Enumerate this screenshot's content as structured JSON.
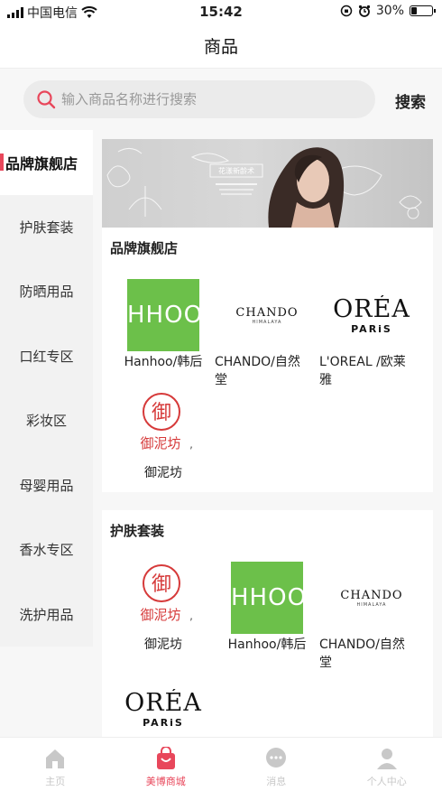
{
  "status_bar": {
    "carrier": "中国电信",
    "time": "15:42",
    "battery": "30%",
    "battery_level": 0.3
  },
  "header": {
    "title": "商品"
  },
  "search": {
    "placeholder": "输入商品名称进行搜索",
    "button_label": "搜索"
  },
  "sidebar": {
    "items": [
      {
        "label": "品牌旗舰店",
        "active": true
      },
      {
        "label": "护肤套装"
      },
      {
        "label": "防晒用品"
      },
      {
        "label": "口红专区"
      },
      {
        "label": "彩妆区"
      },
      {
        "label": "母婴用品"
      },
      {
        "label": "香水专区"
      },
      {
        "label": "洗护用品"
      }
    ]
  },
  "banner": {
    "caption": "花漾新龄术",
    "colors": {
      "accent": "#e8475b",
      "hanhoo_green": "#6cc04a"
    }
  },
  "sections": [
    {
      "title": "品牌旗舰店",
      "brands": [
        {
          "name": "Hanhoo/韩后",
          "logo_text": "HHOO"
        },
        {
          "name_line1": "CHANDO/自然",
          "name_line2": "堂",
          "logo_text": "CHANDO",
          "logo_sub": "HIMALAYA"
        },
        {
          "name_line1": "L'OREAL /欧莱",
          "name_line2": "雅",
          "logo_text": "ORÉA",
          "logo_sub": "PARiS"
        },
        {
          "name": "御泥坊",
          "logo_text": "御泥坊",
          "logo_suffix": ","
        }
      ]
    },
    {
      "title": "护肤套装",
      "brands": [
        {
          "name": "御泥坊",
          "logo_text": "御泥坊",
          "logo_suffix": ","
        },
        {
          "name": "Hanhoo/韩后",
          "logo_text": "HHOO"
        },
        {
          "name_line1": "CHANDO/自然",
          "name_line2": "堂",
          "logo_text": "CHANDO",
          "logo_sub": "HIMALAYA"
        },
        {
          "logo_text": "ORÉA",
          "logo_sub": "PARiS"
        }
      ]
    }
  ],
  "tabbar": {
    "items": [
      {
        "label": "主页",
        "icon": "home-icon"
      },
      {
        "label": "美博商城",
        "icon": "shopping-bag-icon",
        "active": true
      },
      {
        "label": "消息",
        "icon": "chat-icon"
      },
      {
        "label": "个人中心",
        "icon": "user-icon"
      }
    ]
  }
}
